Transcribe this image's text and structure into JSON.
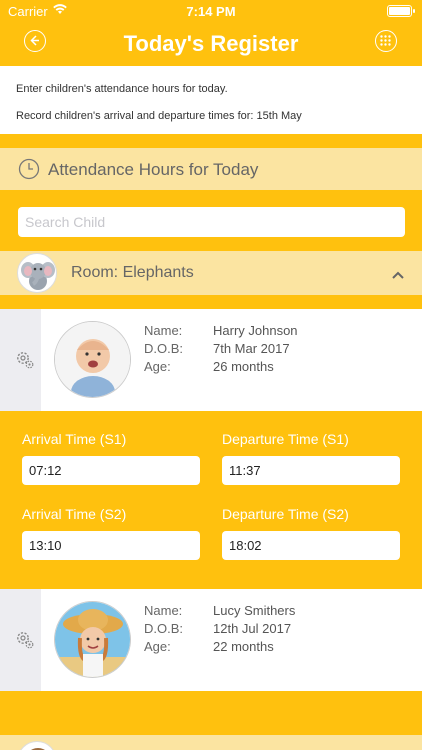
{
  "status_bar": {
    "carrier": "Carrier",
    "time": "7:14 PM"
  },
  "nav": {
    "title": "Today's Register",
    "back_icon": "back-circle-icon",
    "grid_icon": "grid-circle-icon"
  },
  "info": {
    "line1": "Enter children's attendance hours for today.",
    "line2": "Record children's arrival and departure times for: 15th May"
  },
  "attendance_header": {
    "label": "Attendance Hours for Today",
    "icon": "clock-icon"
  },
  "search": {
    "placeholder": "Search Child",
    "value": ""
  },
  "room": {
    "label": "Room: Elephants",
    "icon": "elephant-avatar",
    "expanded": true
  },
  "labels": {
    "name": "Name:",
    "dob": "D.O.B:",
    "age": "Age:"
  },
  "times_labels": {
    "arrival_s1": "Arrival Time (S1)",
    "departure_s1": "Departure Time (S1)",
    "arrival_s2": "Arrival Time (S2)",
    "departure_s2": "Departure Time (S2)"
  },
  "children": [
    {
      "name": "Harry Johnson",
      "dob": "7th Mar 2017",
      "age": "26 months",
      "times": {
        "arrival_s1": "07:12",
        "departure_s1": "11:37",
        "arrival_s2": "13:10",
        "departure_s2": "18:02"
      }
    },
    {
      "name": "Lucy Smithers",
      "dob": "12th Jul 2017",
      "age": "22 months"
    }
  ],
  "colors": {
    "primary": "#FFC10E",
    "header_band": "#FBE4A1",
    "side_panel": "#EDEDF1"
  }
}
